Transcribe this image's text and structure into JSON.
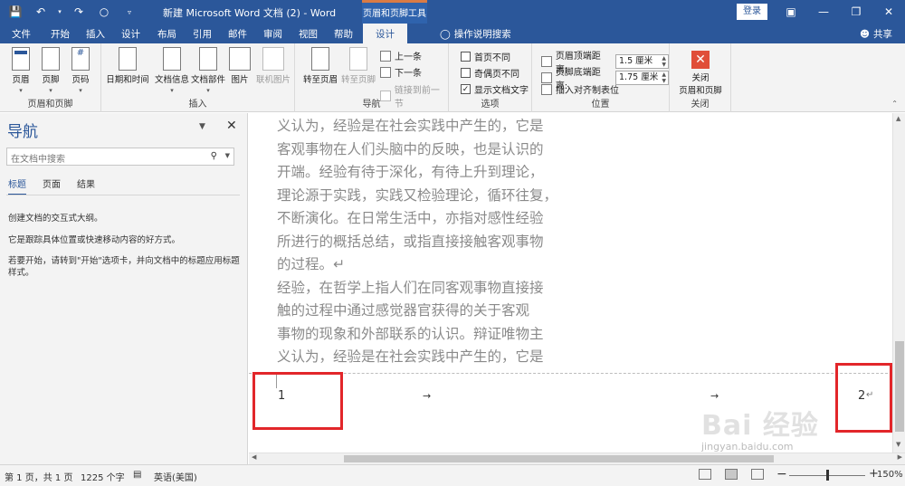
{
  "titlebar": {
    "document_title": "新建 Microsoft Word 文档 (2)  -  Word",
    "context_tool": "页眉和页脚工具",
    "login": "登录",
    "accent": "#2b579a"
  },
  "tabs": [
    "文件",
    "开始",
    "插入",
    "设计",
    "布局",
    "引用",
    "邮件",
    "审阅",
    "视图",
    "帮助"
  ],
  "active_tab": "设计",
  "tellme": "操作说明搜索",
  "share": "共享",
  "ribbon": {
    "group_header_footer": {
      "label": "页眉和页脚",
      "buttons": [
        "页眉",
        "页脚",
        "页码"
      ]
    },
    "group_insert": {
      "label": "插入",
      "buttons": [
        "日期和时间",
        "文档信息",
        "文档部件",
        "图片",
        "联机图片"
      ]
    },
    "group_nav": {
      "label": "导航",
      "goto_header": "转至页眉",
      "goto_footer": "转至页脚",
      "prev": "上一条",
      "next": "下一条",
      "link_prev": "链接到前一节"
    },
    "group_options": {
      "label": "选项",
      "first_page": "首页不同",
      "odd_even": "奇偶页不同",
      "show_text": "显示文档文字",
      "show_text_checked": "✓"
    },
    "group_position": {
      "label": "位置",
      "header_top": "页眉顶端距离:",
      "header_top_value": "1.5 厘米",
      "footer_bottom": "页脚底端距离:",
      "footer_bottom_value": "1.75 厘米",
      "align_tab": "插入对齐制表位"
    },
    "group_close": {
      "label": "关闭",
      "button_line1": "关闭",
      "button_line2": "页眉和页脚"
    }
  },
  "navpane": {
    "title": "导航",
    "search_placeholder": "在文档中搜索",
    "tabs": [
      "标题",
      "页面",
      "结果"
    ],
    "help_lines": [
      "创建文档的交互式大纲。",
      "它是跟踪具体位置或快速移动内容的好方式。",
      "若要开始，请转到\"开始\"选项卡，并向文档中的标题应用标题",
      "样式。"
    ]
  },
  "document": {
    "lines": [
      "义认为，经验是在社会实践中产生的，它是",
      "客观事物在人们头脑中的反映，也是认识的",
      "开端。经验有待于深化，有待上升到理论，",
      "理论源于实践，实践又检验理论，循环往复，",
      "不断演化。在日常生活中，亦指对感性经验",
      "所进行的概括总结，或指直接接触客观事物",
      "的过程。↵",
      "经验，在哲学上指人们在同客观事物直接接",
      "触的过程中通过感觉器官获得的关于客观",
      "事物的现象和外部联系的认识。辩证唯物主",
      "义认为，经验是在社会实践中产生的，它是"
    ],
    "footer_page_left": "1",
    "footer_tab_arrow": "→",
    "footer_page_right": "2",
    "footer_para_mark": "↵",
    "highlight_color": "#e2262a"
  },
  "watermark": {
    "text": "Bai 经验",
    "url": "jingyan.baidu.com"
  },
  "statusbar": {
    "page": "第 1 页，共 1 页",
    "words": "1225 个字",
    "language": "英语(美国)",
    "zoom": "150%"
  }
}
